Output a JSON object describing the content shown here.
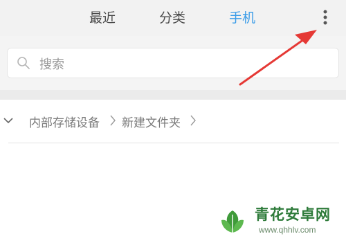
{
  "tabs": [
    {
      "label": "最近",
      "active": false
    },
    {
      "label": "分类",
      "active": false
    },
    {
      "label": "手机",
      "active": true
    }
  ],
  "colors": {
    "active_tab": "#3a9ce8",
    "annotation_arrow": "#e53935"
  },
  "icons": {
    "more": "vertical-dots-icon",
    "search": "search-icon",
    "expand": "chevron-down-icon",
    "separator": "chevron-right-icon"
  },
  "search": {
    "placeholder": "搜索"
  },
  "breadcrumb": {
    "items": [
      "内部存储设备",
      "新建文件夹"
    ]
  },
  "watermark": {
    "title": "青花安卓网",
    "url": "www.qhhlv.com"
  }
}
